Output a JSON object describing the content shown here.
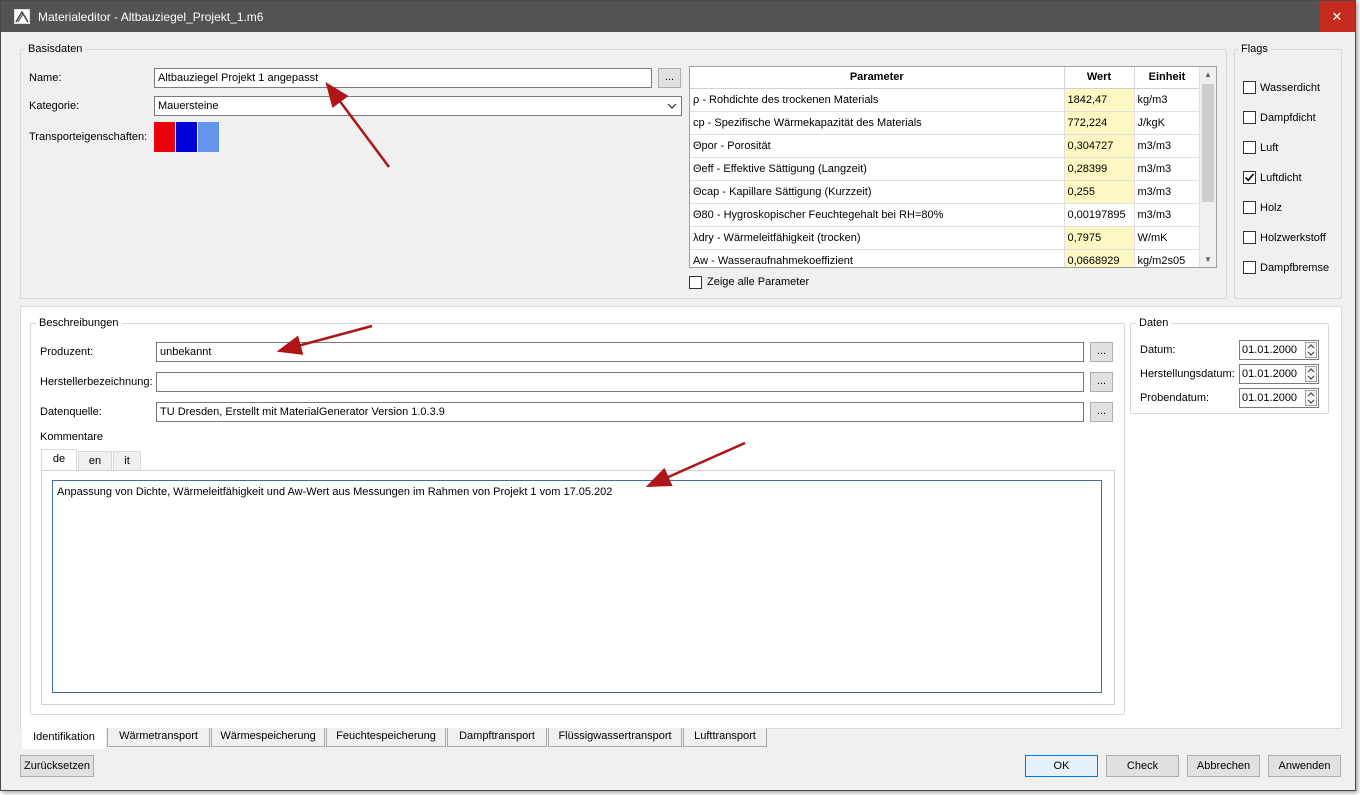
{
  "window": {
    "title": "Materialeditor - Altbauziegel_Projekt_1.m6",
    "close": "✕"
  },
  "basisdaten": {
    "title": "Basisdaten",
    "name_label": "Name:",
    "name_value": "Altbauziegel Projekt 1 angepasst",
    "kategorie_label": "Kategorie:",
    "kategorie_value": "Mauersteine",
    "transport_label": "Transporteigenschaften:",
    "swatch_colors": [
      "#e8000b",
      "#0000d8",
      "#6495ed"
    ],
    "dots": "..."
  },
  "params_table": {
    "headers": [
      "Parameter",
      "Wert",
      "Einheit"
    ],
    "rows": [
      [
        "ρ - Rohdichte des trockenen Materials",
        "1842,47",
        "kg/m3"
      ],
      [
        "cp - Spezifische Wärmekapazität des Materials",
        "772,224",
        "J/kgK"
      ],
      [
        "Θpor - Porosität",
        "0,304727",
        "m3/m3"
      ],
      [
        "Θeff - Effektive Sättigung (Langzeit)",
        "0,28399",
        "m3/m3"
      ],
      [
        "Θcap - Kapillare Sättigung (Kurzzeit)",
        "0,255",
        "m3/m3"
      ],
      [
        "Θ80 - Hygroskopischer Feuchtegehalt bei RH=80%",
        "0,00197895",
        "m3/m3"
      ],
      [
        "λdry - Wärmeleitfähigkeit (trocken)",
        "0,7975",
        "W/mK"
      ],
      [
        "Aw - Wasseraufnahmekoeffizient",
        "0,0668929",
        "kg/m2s05"
      ]
    ],
    "show_all_label": "Zeige alle Parameter"
  },
  "flags": {
    "title": "Flags",
    "items": [
      {
        "label": "Wasserdicht",
        "checked": false
      },
      {
        "label": "Dampfdicht",
        "checked": false
      },
      {
        "label": "Luft",
        "checked": false
      },
      {
        "label": "Luftdicht",
        "checked": true
      },
      {
        "label": "Holz",
        "checked": false
      },
      {
        "label": "Holzwerkstoff",
        "checked": false
      },
      {
        "label": "Dampfbremse",
        "checked": false
      }
    ]
  },
  "beschreibungen": {
    "title": "Beschreibungen",
    "produzent_label": "Produzent:",
    "produzent_value": "unbekannt",
    "hersteller_label": "Herstellerbezeichnung:",
    "hersteller_value": "",
    "datenquelle_label": "Datenquelle:",
    "datenquelle_value": "TU Dresden, Erstellt mit MaterialGenerator Version 1.0.3.9",
    "kommentare_label": "Kommentare",
    "lang_tabs": [
      "de",
      "en",
      "it"
    ],
    "comment_text": "Anpassung von Dichte, Wärmeleitfähigkeit und Aw-Wert aus Messungen im Rahmen von Projekt 1 vom 17.05.202"
  },
  "daten": {
    "title": "Daten",
    "datum_label": "Datum:",
    "datum_value": "01.01.2000",
    "herstellungsdatum_label": "Herstellungsdatum:",
    "herstellungsdatum_value": "01.01.2000",
    "probendatum_label": "Probendatum:",
    "probendatum_value": "01.01.2000"
  },
  "bottom_tabs": [
    "Identifikation",
    "Wärmetransport",
    "Wärmespeicherung",
    "Feuchtespeicherung",
    "Dampftransport",
    "Flüssigwassertransport",
    "Lufttransport"
  ],
  "buttons": {
    "reset": "Zurücksetzen",
    "ok": "OK",
    "check": "Check",
    "cancel": "Abbrechen",
    "apply": "Anwenden"
  },
  "colors": {
    "annotation_arrow": "#b01515",
    "titlebar": "#535353",
    "value_cell": "#fdf7c3"
  }
}
